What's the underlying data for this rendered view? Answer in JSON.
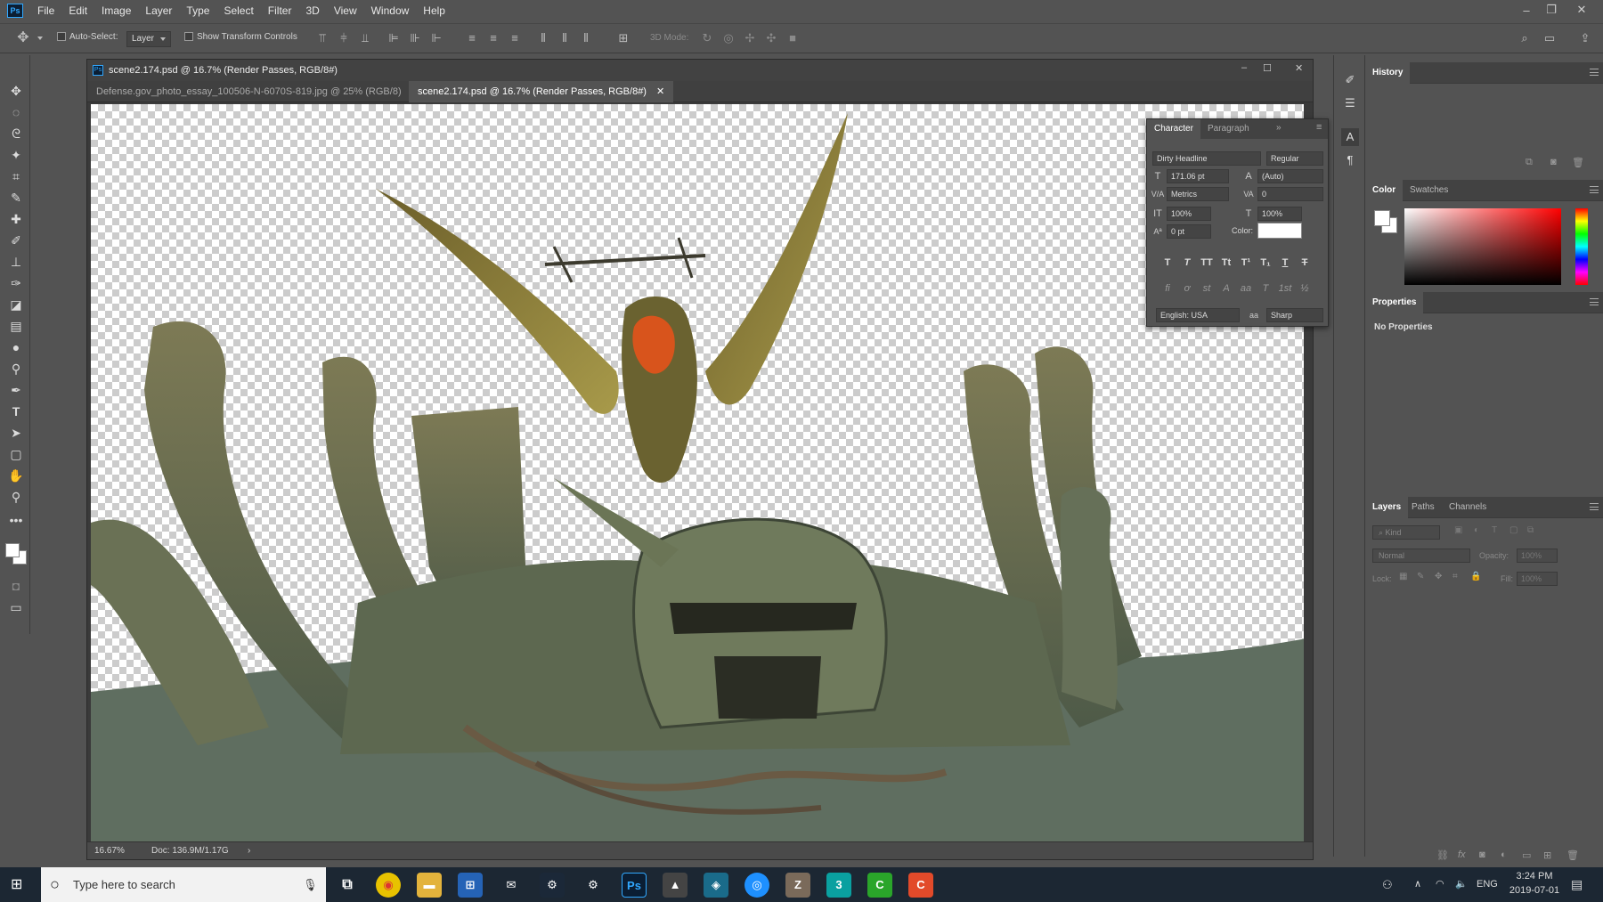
{
  "app": {
    "logo": "Ps"
  },
  "menu": [
    "File",
    "Edit",
    "Image",
    "Layer",
    "Type",
    "Select",
    "Filter",
    "3D",
    "View",
    "Window",
    "Help"
  ],
  "options": {
    "auto_select_label": "Auto-Select:",
    "auto_select_value": "Layer",
    "transform_label": "Show Transform Controls",
    "mode_3d_label": "3D Mode:"
  },
  "document": {
    "window_title": "scene2.174.psd @ 16.7% (Render Passes, RGB/8#)",
    "tabs": [
      {
        "label": "Defense.gov_photo_essay_100506-N-6070S-819.jpg @ 25% (RGB/8)"
      },
      {
        "label": "scene2.174.psd @ 16.7% (Render Passes, RGB/8#)"
      }
    ],
    "zoom": "16.67%",
    "doc_size": "Doc: 136.9M/1.17G"
  },
  "character": {
    "tabs": [
      "Character",
      "Paragraph"
    ],
    "font_family": "Dirty Headline",
    "font_style": "Regular",
    "font_size": "171.06 pt",
    "leading": "(Auto)",
    "kerning": "Metrics",
    "tracking": "0",
    "vertical_scale": "100%",
    "horizontal_scale": "100%",
    "baseline_shift": "0 pt",
    "color_label": "Color:",
    "language": "English: USA",
    "antialias_label": "aa",
    "antialias": "Sharp",
    "type_buttons": [
      "T",
      "T",
      "TT",
      "Tt",
      "T¹",
      "T₁",
      "T",
      "T"
    ],
    "opentype_buttons": [
      "fi",
      "ơ",
      "st",
      "A",
      "aa",
      "T",
      "1st",
      "½"
    ]
  },
  "panels": {
    "history": {
      "tab": "History"
    },
    "color": {
      "tabs": [
        "Color",
        "Swatches"
      ]
    },
    "properties": {
      "tab": "Properties",
      "message": "No Properties"
    },
    "layers": {
      "tabs": [
        "Layers",
        "Paths",
        "Channels"
      ],
      "kind_placeholder": "Kind",
      "blend_mode": "Normal",
      "opacity_label": "Opacity:",
      "opacity_value": "100%",
      "lock_label": "Lock:",
      "fill_label": "Fill:",
      "fill_value": "100%"
    }
  },
  "taskbar": {
    "search_placeholder": "Type here to search",
    "language": "ENG",
    "time": "3:24 PM",
    "date": "2019-07-01"
  },
  "colors": {
    "ui_bg": "#535353",
    "panel_dark": "#424242",
    "taskbar": "#1c2733",
    "ps_blue": "#31a8ff"
  }
}
